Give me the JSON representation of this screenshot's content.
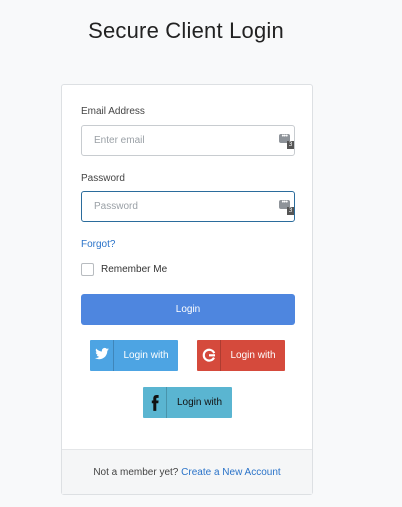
{
  "page": {
    "title": "Secure Client Login"
  },
  "form": {
    "email": {
      "label": "Email Address",
      "placeholder": "Enter email",
      "value": ""
    },
    "password": {
      "label": "Password",
      "placeholder": "Password",
      "value": ""
    },
    "password_manager_badge": "3",
    "forgot_label": "Forgot?",
    "remember_label": "Remember Me",
    "remember_checked": false,
    "login_label": "Login"
  },
  "social": {
    "twitter": {
      "label": "Login with",
      "icon": "twitter-icon",
      "color": "#4da4e3"
    },
    "google": {
      "label": "Login with",
      "icon": "google-icon",
      "color": "#d54a3c"
    },
    "facebook": {
      "label": "Login with",
      "icon": "facebook-icon",
      "color": "#5ab5d1"
    }
  },
  "footer": {
    "prompt": "Not a member yet?",
    "link": "Create a New Account"
  },
  "colors": {
    "primary": "#4e86df",
    "link": "#2a73c9",
    "focus_border": "#2b6c9c"
  }
}
